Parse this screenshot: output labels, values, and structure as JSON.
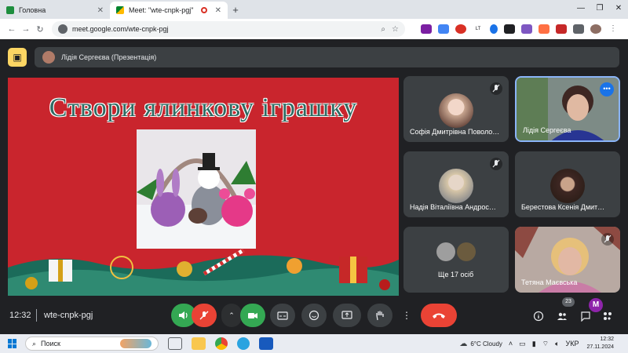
{
  "browser": {
    "tabs": [
      {
        "title": "Головна",
        "active": false
      },
      {
        "title": "Meet: \"wte-cnpk-pgj\"",
        "active": true
      }
    ],
    "url": "meet.google.com/wte-cnpk-pgj"
  },
  "meet": {
    "presenter_label": "Лідія Сергеєва (Презентація)",
    "slide": {
      "title": "Створи ялинкову іграшку"
    },
    "participants": [
      {
        "name": "Софія Дмитрівна Поволо…",
        "muted": true
      },
      {
        "name": "Лідія Сергеєва",
        "muted": false,
        "active_speaker": true
      },
      {
        "name": "Надія Віталіївна Андрос…",
        "muted": true
      },
      {
        "name": "Берестова Ксенія Дмит…",
        "muted": false
      },
      {
        "name": "Ще 17 осіб",
        "muted": false
      },
      {
        "name": "Тетяна Маєвська",
        "muted": true
      }
    ],
    "controls": {
      "time": "12:32",
      "meeting_code": "wte-cnpk-pgj",
      "participants_count": "23"
    }
  },
  "taskbar": {
    "search_placeholder": "Поиск",
    "weather": "6°C  Cloudy",
    "language": "УКР",
    "time": "12:32",
    "date": "27.11.2024"
  },
  "colors": {
    "meet_bg": "#202124",
    "tile_bg": "#3c4043",
    "slide_bg": "#c9252d",
    "title_teal": "#2e6b63",
    "mic_on_green": "#34a853",
    "hangup_red": "#ea4335",
    "presenter_yellow": "#fdd663",
    "active_speaker_border": "#8ab4f8"
  }
}
